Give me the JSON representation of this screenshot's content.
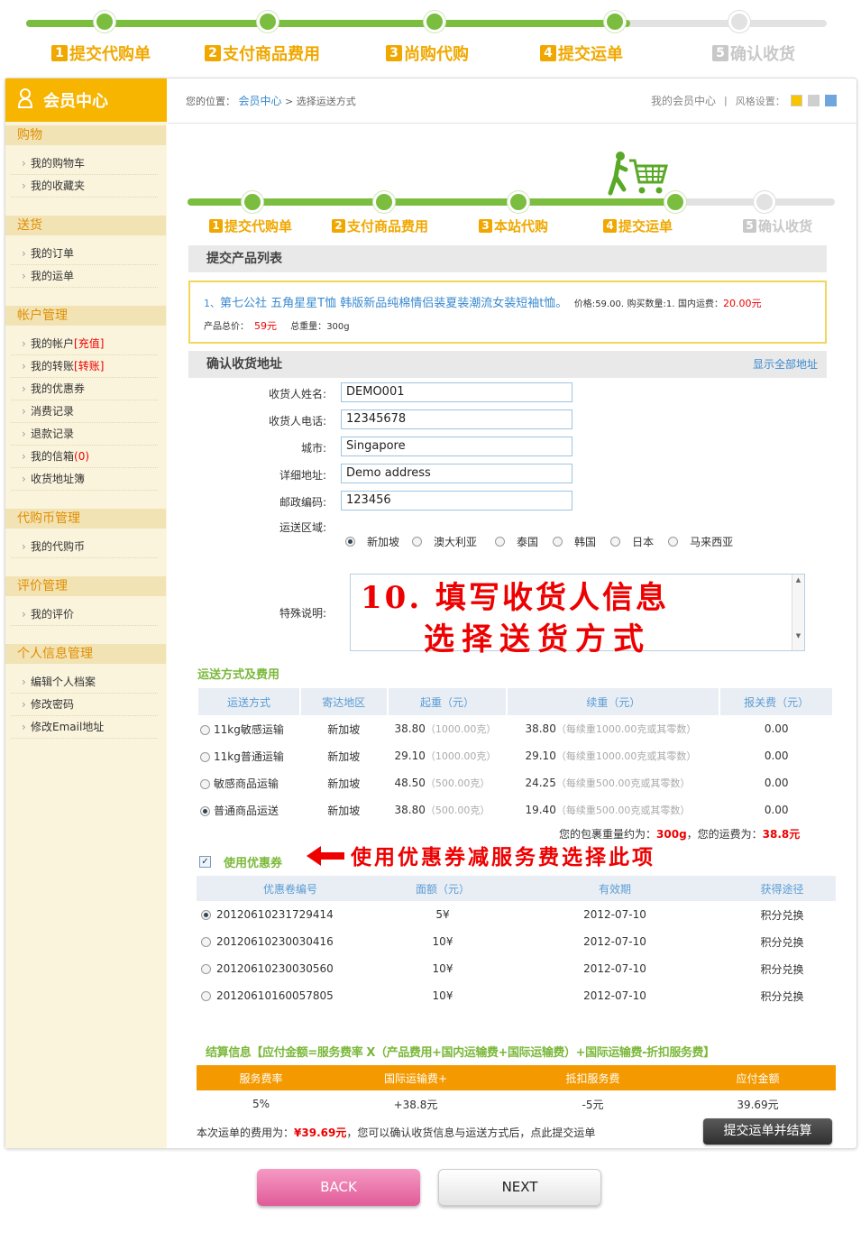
{
  "top_steps": [
    {
      "n": "1",
      "label": "提交代购单",
      "active": true
    },
    {
      "n": "2",
      "label": "支付商品费用",
      "active": true
    },
    {
      "n": "3",
      "label": "尚购代购",
      "active": true
    },
    {
      "n": "4",
      "label": "提交运单",
      "active": true
    },
    {
      "n": "5",
      "label": "确认收货",
      "active": false
    }
  ],
  "sidebar": {
    "title": "会员中心",
    "groups": [
      {
        "name": "购物",
        "items": [
          {
            "label": "我的购物车"
          },
          {
            "label": "我的收藏夹"
          }
        ]
      },
      {
        "name": "送货",
        "items": [
          {
            "label": "我的订单"
          },
          {
            "label": "我的运单"
          }
        ]
      },
      {
        "name": "帐户管理",
        "items": [
          {
            "label": "我的帐户",
            "tag": "[充值]"
          },
          {
            "label": "我的转账",
            "tag": "[转账]"
          },
          {
            "label": "我的优惠券"
          },
          {
            "label": "消费记录"
          },
          {
            "label": "退款记录"
          },
          {
            "label": "我的信箱",
            "tag": "(0)"
          },
          {
            "label": "收货地址簿"
          }
        ]
      },
      {
        "name": "代购币管理",
        "items": [
          {
            "label": "我的代购币"
          }
        ]
      },
      {
        "name": "评价管理",
        "items": [
          {
            "label": "我的评价"
          }
        ]
      },
      {
        "name": "个人信息管理",
        "items": [
          {
            "label": "编辑个人档案"
          },
          {
            "label": "修改密码"
          },
          {
            "label": "修改Email地址"
          }
        ]
      }
    ]
  },
  "header": {
    "location_label": "您的位置：",
    "crumb_home": "会员中心",
    "crumb_sep": ">",
    "crumb_current": "选择运送方式",
    "my_member": "我的会员中心",
    "divider": "|",
    "style_label": "风格设置：",
    "style_colors": [
      "#f7c400",
      "#cfcfcf",
      "#6ea6dd"
    ]
  },
  "inner_steps": [
    {
      "n": "1",
      "label": "提交代购单",
      "active": true
    },
    {
      "n": "2",
      "label": "支付商品费用",
      "active": true
    },
    {
      "n": "3",
      "label": "本站代购",
      "active": true
    },
    {
      "n": "4",
      "label": "提交运单",
      "active": true
    },
    {
      "n": "5",
      "label": "确认收货",
      "active": false
    }
  ],
  "products": {
    "section_title": "提交产品列表",
    "item_index": "1、",
    "item_name": "第七公社 五角星星T恤 韩版新品纯棉情侣装夏装潮流女装短袖t恤。",
    "price_label": "价格:",
    "price": "59.00",
    "qty_label": "购买数量:",
    "qty": "1",
    "domestic_label": "国内运费：",
    "domestic": "20.00元",
    "total_label": "产品总价：",
    "total": "59元",
    "weight_label": "总重量：",
    "weight": "300g"
  },
  "address": {
    "section_title": "确认收货地址",
    "show_all": "显示全部地址",
    "fields": [
      {
        "label": "收货人姓名:",
        "value": "DEMO001"
      },
      {
        "label": "收货人电话:",
        "value": "12345678"
      },
      {
        "label": "城市:",
        "value": "Singapore"
      },
      {
        "label": "详细地址:",
        "value": "Demo address"
      },
      {
        "label": "邮政编码:",
        "value": "123456"
      }
    ],
    "region_label": "运送区域:",
    "regions": [
      {
        "label": "新加坡",
        "checked": true
      },
      {
        "label": "澳大利亚",
        "checked": false
      },
      {
        "label": "泰国",
        "checked": false
      },
      {
        "label": "韩国",
        "checked": false
      },
      {
        "label": "日本",
        "checked": false
      },
      {
        "label": "马来西亚",
        "checked": false
      }
    ],
    "note_label": "特殊说明:"
  },
  "annotation_1": {
    "line1": "10. 填写收货人信息",
    "line2": "选择送货方式"
  },
  "shipping": {
    "title": "运送方式及费用",
    "headers": [
      "运送方式",
      "寄达地区",
      "起重（元）",
      "续重（元）",
      "报关费（元）"
    ],
    "rows": [
      {
        "name": "11kg敏感运输",
        "region": "新加坡",
        "start": "38.80",
        "start_note": "（1000.00克）",
        "cont": "38.80",
        "cont_note": "（每续重1000.00克或其零数）",
        "customs": "0.00",
        "checked": false
      },
      {
        "name": "11kg普通运输",
        "region": "新加坡",
        "start": "29.10",
        "start_note": "（1000.00克）",
        "cont": "29.10",
        "cont_note": "（每续重1000.00克或其零数）",
        "customs": "0.00",
        "checked": false
      },
      {
        "name": "敏感商品运输",
        "region": "新加坡",
        "start": "48.50",
        "start_note": "（500.00克）",
        "cont": "24.25",
        "cont_note": "（每续重500.00克或其零数）",
        "customs": "0.00",
        "checked": false
      },
      {
        "name": "普通商品运送",
        "region": "新加坡",
        "start": "38.80",
        "start_note": "（500.00克）",
        "cont": "19.40",
        "cont_note": "（每续重500.00克或其零数）",
        "customs": "0.00",
        "checked": true
      }
    ],
    "summary_prefix": "您的包裹重量约为：",
    "summary_weight": "300g",
    "summary_mid": "，您的运费为：",
    "summary_fee": "38.8元"
  },
  "coupon": {
    "checkbox_label": "使用优惠券",
    "checked": true,
    "annotation": "使用优惠券减服务费选择此项",
    "headers": [
      "优惠卷编号",
      "面额（元）",
      "有效期",
      "获得途径"
    ],
    "rows": [
      {
        "code": "2012061023172941​4",
        "amount": "5¥",
        "expiry": "2012-07-10",
        "source": "积分兑换",
        "checked": true
      },
      {
        "code": "20120610230030416",
        "amount": "10¥",
        "expiry": "2012-07-10",
        "source": "积分兑换",
        "checked": false
      },
      {
        "code": "20120610230030560",
        "amount": "10¥",
        "expiry": "2012-07-10",
        "source": "积分兑换",
        "checked": false
      },
      {
        "code": "20120610160057805",
        "amount": "10¥",
        "expiry": "2012-07-10",
        "source": "积分兑换",
        "checked": false
      }
    ]
  },
  "settlement": {
    "title": "结算信息【应付金额=服务费率 X（产品费用+国内运输费+国际运输费）+国际运输费-折扣服务费】",
    "headers": [
      "服务费率",
      "国际运输费+",
      "抵扣服务费",
      "应付金额"
    ],
    "values": [
      "5%",
      "+38.8元",
      "-5元",
      "39.69元"
    ],
    "footer_prefix": "本次运单的费用为：",
    "footer_amount": "¥39.69元",
    "footer_suffix": "，您可以确认收货信息与运送方式后，点此提交运单",
    "submit_label": "提交运单并结算"
  },
  "nav": {
    "back": "BACK",
    "next": "NEXT"
  }
}
